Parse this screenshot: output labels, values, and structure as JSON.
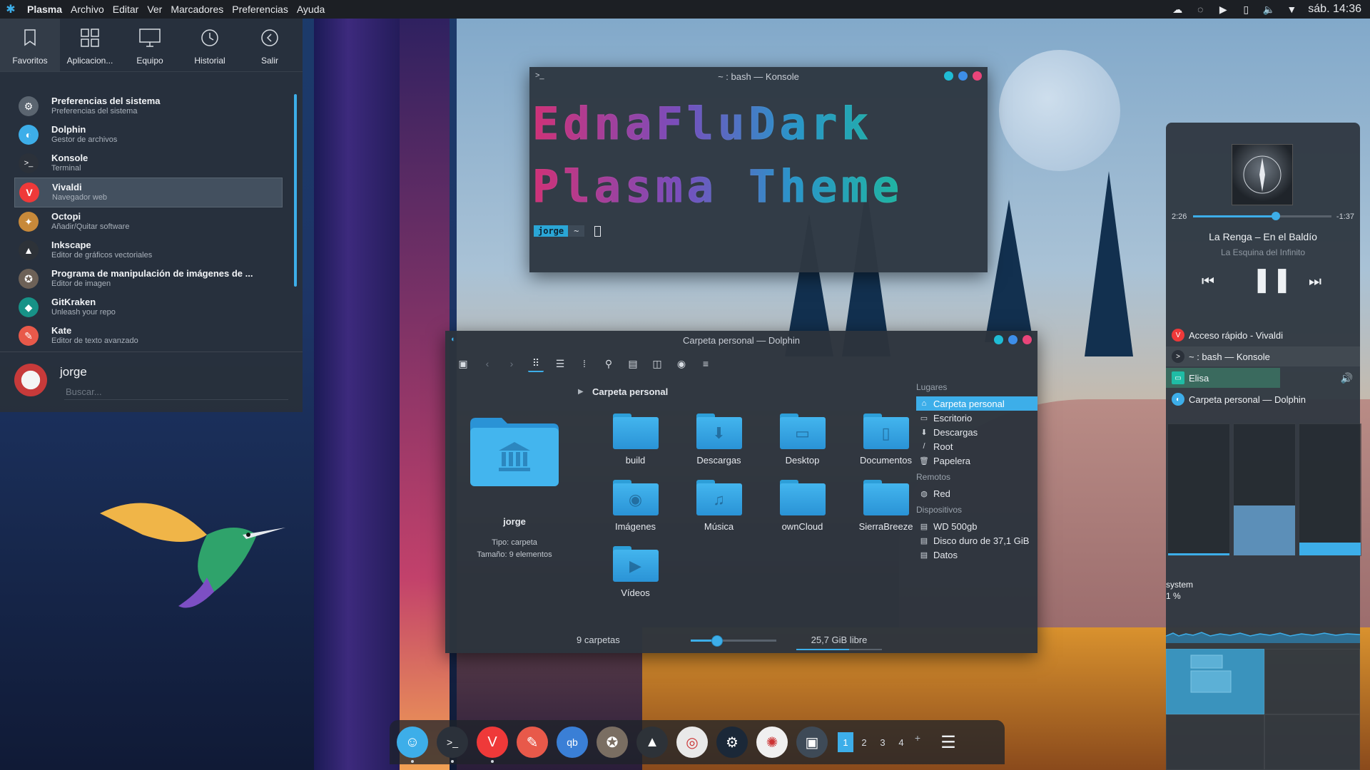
{
  "topbar": {
    "menu": [
      "Plasma",
      "Archivo",
      "Editar",
      "Ver",
      "Marcadores",
      "Preferencias",
      "Ayuda"
    ],
    "clock": "sáb. 14:36",
    "tray_icons": [
      "cloud-icon",
      "updates-icon",
      "media-icon",
      "battery-icon",
      "volume-icon",
      "expand-tray-icon"
    ]
  },
  "launcher": {
    "tabs": [
      {
        "label": "Favoritos",
        "icon": "bookmark-icon"
      },
      {
        "label": "Aplicacion...",
        "icon": "apps-grid-icon"
      },
      {
        "label": "Equipo",
        "icon": "computer-icon"
      },
      {
        "label": "Historial",
        "icon": "history-icon"
      },
      {
        "label": "Salir",
        "icon": "leave-icon"
      }
    ],
    "favorites": [
      {
        "name": "Preferencias del sistema",
        "desc": "Preferencias del sistema",
        "icon": "settings-icon",
        "color": "#5b6570"
      },
      {
        "name": "Dolphin",
        "desc": "Gestor de archivos",
        "icon": "dolphin-icon",
        "color": "#3daee9"
      },
      {
        "name": "Konsole",
        "desc": "Terminal",
        "icon": "terminal-icon",
        "color": "#2b313a"
      },
      {
        "name": "Vivaldi",
        "desc": "Navegador web",
        "icon": "vivaldi-icon",
        "color": "#ef3939"
      },
      {
        "name": "Octopi",
        "desc": "Añadir/Quitar software",
        "icon": "octopi-icon",
        "color": "#c7893a"
      },
      {
        "name": "Inkscape",
        "desc": "Editor de gráficos vectoriales",
        "icon": "inkscape-icon",
        "color": "#2d3238"
      },
      {
        "name": "Programa de manipulación de imágenes de ...",
        "desc": "Editor de imagen",
        "icon": "gimp-icon",
        "color": "#6d6157"
      },
      {
        "name": "GitKraken",
        "desc": "Unleash your repo",
        "icon": "gitkraken-icon",
        "color": "#179287"
      },
      {
        "name": "Kate",
        "desc": "Editor de texto avanzado",
        "icon": "kate-icon",
        "color": "#e8594a"
      }
    ],
    "user": "jorge",
    "search_placeholder": "Buscar..."
  },
  "konsole": {
    "title": "~ : bash — Konsole",
    "ascii_lines": [
      "EdnaFluDark",
      "Plasma Theme"
    ],
    "prompt_user": "jorge",
    "prompt_dir": "~"
  },
  "dolphin": {
    "title": "Carpeta personal — Dolphin",
    "breadcrumb": "Carpeta personal",
    "info": {
      "name": "jorge",
      "type_label": "Tipo:",
      "type_value": "carpeta",
      "size_label": "Tamaño:",
      "size_value": "9 elementos"
    },
    "folders": [
      {
        "name": "build",
        "glyph": ""
      },
      {
        "name": "Descargas",
        "glyph": "⬇"
      },
      {
        "name": "Desktop",
        "glyph": "▭"
      },
      {
        "name": "Documentos",
        "glyph": "▯"
      },
      {
        "name": "Imágenes",
        "glyph": "◉"
      },
      {
        "name": "Música",
        "glyph": "♫"
      },
      {
        "name": "ownCloud",
        "glyph": ""
      },
      {
        "name": "SierraBreeze",
        "glyph": ""
      },
      {
        "name": "Vídeos",
        "glyph": "▶"
      }
    ],
    "places": {
      "lugares_header": "Lugares",
      "lugares": [
        "Carpeta personal",
        "Escritorio",
        "Descargas",
        "Root",
        "Papelera"
      ],
      "remotos_header": "Remotos",
      "remotos": [
        "Red"
      ],
      "dispositivos_header": "Dispositivos",
      "dispositivos": [
        "WD 500gb",
        "Disco duro de 37,1 GiB",
        "Datos"
      ]
    },
    "status_count": "9 carpetas",
    "zoom_level": 0.3,
    "free_space": "25,7 GiB libre",
    "used_fraction": 0.62
  },
  "media": {
    "elapsed": "2:26",
    "remaining": "-1:37",
    "progress": 0.6,
    "song": "La Renga – En el Baldío",
    "album": "La Esquina del Infinito"
  },
  "tasks": [
    {
      "label": "Acceso rápido - Vivaldi",
      "icon": "vivaldi-icon",
      "color": "#ef3939"
    },
    {
      "label": "~ : bash — Konsole",
      "icon": "terminal-icon",
      "color": "#2b313a"
    },
    {
      "label": "Elisa",
      "icon": "elisa-icon",
      "color": "#1fbca5"
    },
    {
      "label": "Carpeta personal — Dolphin",
      "icon": "dolphin-icon",
      "color": "#3daee9"
    }
  ],
  "meters": [
    0.0,
    0.38,
    0.1
  ],
  "system": {
    "label": "system",
    "value": "1 %"
  },
  "dock": {
    "apps": [
      {
        "name": "finder-icon",
        "color": "#3daee9",
        "glyph": "☺"
      },
      {
        "name": "terminal-icon",
        "color": "#2b313a",
        "glyph": ">_"
      },
      {
        "name": "vivaldi-icon",
        "color": "#ef3939",
        "glyph": "V"
      },
      {
        "name": "kate-icon",
        "color": "#e8594a",
        "glyph": "✎"
      },
      {
        "name": "qbittorrent-icon",
        "color": "#3a7fd6",
        "glyph": "qb"
      },
      {
        "name": "gimp-icon",
        "color": "#7a6e62",
        "glyph": "✪"
      },
      {
        "name": "inkscape-icon",
        "color": "#2d3238",
        "glyph": "▲"
      },
      {
        "name": "disc-icon",
        "color": "#e9e9e9",
        "glyph": "◎"
      },
      {
        "name": "steam-icon",
        "color": "#1b2838",
        "glyph": "⚙"
      },
      {
        "name": "lifesaver-icon",
        "color": "#f0f0f0",
        "glyph": "✺"
      },
      {
        "name": "package-icon",
        "color": "#3e4a57",
        "glyph": "▣"
      }
    ],
    "desktops": [
      "1",
      "2",
      "3",
      "4"
    ],
    "add_label": "+"
  }
}
